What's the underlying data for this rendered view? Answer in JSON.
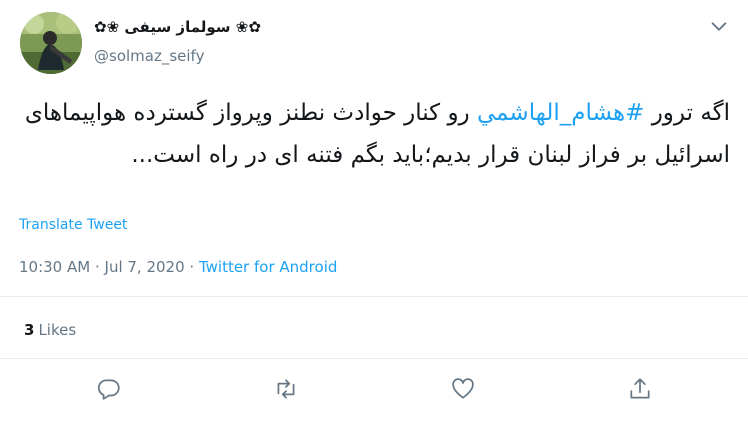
{
  "user": {
    "display_name": "✿❀ سولماز سیفی ❀✿",
    "handle": "@solmaz_seify"
  },
  "tweet": {
    "before_hashtag": "اگه ترور ",
    "hashtag": "#هشام_الهاشمي",
    "after_hashtag": " رو کنار حوادث نطنز وپرواز گسترده هواپیماهای اسرائیل بر فراز لبنان قرار بدیم؛باید بگم فتنه ای در راه است...",
    "translate_label": "Translate Tweet"
  },
  "meta": {
    "time": "10:30 AM",
    "sep1": " · ",
    "date": "Jul 7, 2020",
    "sep2": " · ",
    "app": "Twitter for Android"
  },
  "stats": {
    "likes_count": "3",
    "likes_label": "Likes"
  },
  "icons": {
    "menu": "chevron-down-icon",
    "reply": "reply-icon",
    "retweet": "retweet-icon",
    "like": "heart-icon",
    "share": "share-icon"
  },
  "colors": {
    "link": "#1da1f2",
    "secondary": "#657786",
    "divider": "#e6ecf0"
  }
}
